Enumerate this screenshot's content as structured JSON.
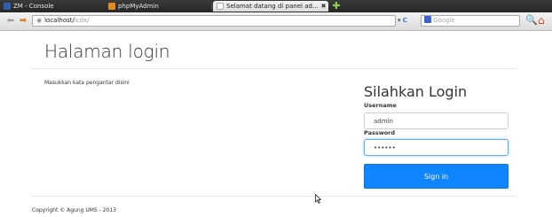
{
  "browser": {
    "tabs": [
      {
        "label": "ZM - Console"
      },
      {
        "label": "phpMyAdmin"
      },
      {
        "label": "Selamat datang di panel ad...",
        "close": "✖"
      }
    ],
    "new_tab": "✚",
    "nav": {
      "back": "⬅",
      "forward": "➡"
    },
    "url": {
      "host": "localhost/",
      "path": "icdx/"
    },
    "url_tools": {
      "dropdown": "▾",
      "reload": "C"
    },
    "search": {
      "placeholder": "Google"
    },
    "search_go": "🔍",
    "home": "⌂"
  },
  "page": {
    "title": "Halaman login",
    "hint": "Masukkan kata pengantar disini",
    "form": {
      "title": "Silahkan Login",
      "username_label": "Username",
      "username_value": "admin",
      "password_label": "Password",
      "password_value": "secret",
      "submit_label": "Sign in"
    },
    "footer": "Copyright © Agung UMS - 2013"
  },
  "colors": {
    "accent": "#0f85ff",
    "focus": "#66afe9"
  }
}
